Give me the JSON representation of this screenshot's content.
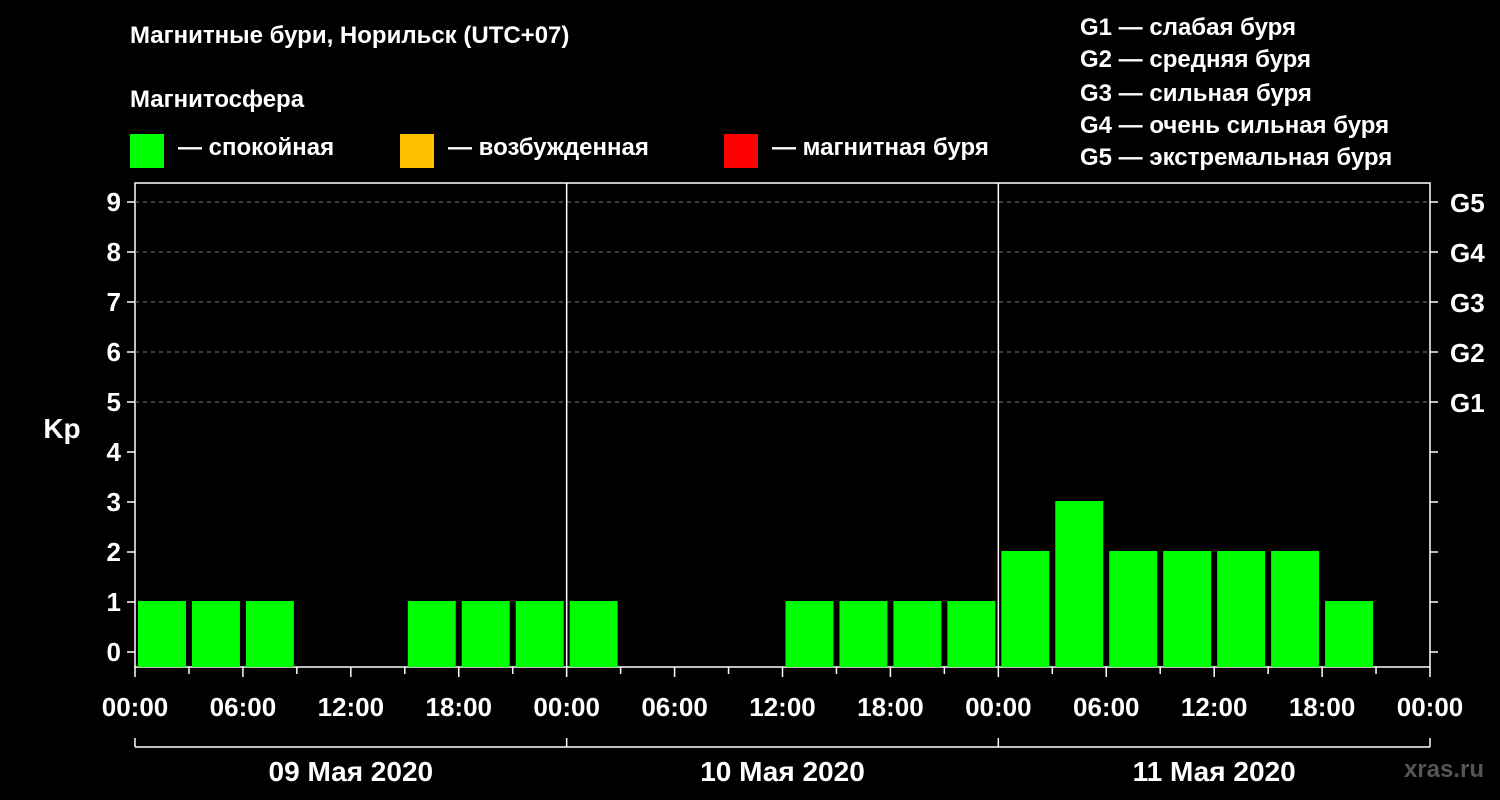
{
  "title": "Магнитные бури, Норильск (UTC+07)",
  "legend": {
    "heading": "Магнитосфера",
    "items": [
      {
        "label": "— спокойная",
        "color": "#00ff00"
      },
      {
        "label": "— возбужденная",
        "color": "#ffc000"
      },
      {
        "label": "— магнитная буря",
        "color": "#ff0000"
      }
    ]
  },
  "g_scale": [
    {
      "label": "G1 — слабая буря"
    },
    {
      "label": "G2 — средняя буря"
    },
    {
      "label": "G3 — сильная буря"
    },
    {
      "label": "G4 — очень сильная буря"
    },
    {
      "label": "G5 — экстремальная буря"
    }
  ],
  "watermark": "xras.ru",
  "chart_data": {
    "type": "bar",
    "ylabel": "Kp",
    "ylim": [
      0,
      9
    ],
    "yticks": [
      "0",
      "1",
      "2",
      "3",
      "4",
      "5",
      "6",
      "7",
      "8",
      "9"
    ],
    "right_ticks": [
      {
        "value": 5,
        "label": "G1"
      },
      {
        "value": 6,
        "label": "G2"
      },
      {
        "value": 7,
        "label": "G3"
      },
      {
        "value": 8,
        "label": "G4"
      },
      {
        "value": 9,
        "label": "G5"
      }
    ],
    "xticks": [
      "00:00",
      "06:00",
      "12:00",
      "18:00",
      "00:00",
      "06:00",
      "12:00",
      "18:00",
      "00:00",
      "06:00",
      "12:00",
      "18:00",
      "00:00"
    ],
    "days": [
      "09 Мая 2020",
      "10 Мая 2020",
      "11 Мая 2020"
    ],
    "interval_hours": 3,
    "grid": "dashed horizontal lines at Kp 5–9",
    "colors": {
      "quiet": "#00ff00",
      "active": "#ffc000",
      "storm": "#ff0000"
    },
    "values": [
      1,
      1,
      1,
      0,
      0,
      1,
      1,
      1,
      1,
      0,
      0,
      0,
      1,
      1,
      1,
      1,
      2,
      3,
      2,
      2,
      2,
      2,
      1,
      0
    ]
  }
}
